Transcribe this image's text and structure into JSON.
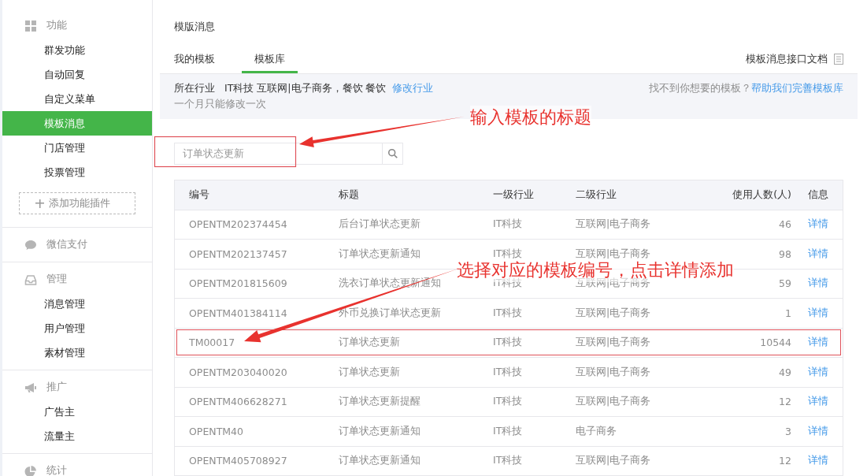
{
  "sidebar": {
    "sections": [
      {
        "label": "功能",
        "items": [
          {
            "label": "群发功能",
            "selected": false
          },
          {
            "label": "自动回复",
            "selected": false
          },
          {
            "label": "自定义菜单",
            "selected": false
          },
          {
            "label": "模板消息",
            "selected": true
          },
          {
            "label": "门店管理",
            "selected": false
          },
          {
            "label": "投票管理",
            "selected": false
          }
        ],
        "add_button": "添加功能插件"
      },
      {
        "label": "微信支付"
      },
      {
        "label": "管理",
        "items": [
          {
            "label": "消息管理",
            "selected": false
          },
          {
            "label": "用户管理",
            "selected": false
          },
          {
            "label": "素材管理",
            "selected": false
          }
        ]
      },
      {
        "label": "推广",
        "items": [
          {
            "label": "广告主",
            "selected": false
          },
          {
            "label": "流量主",
            "selected": false
          }
        ]
      },
      {
        "label": "统计"
      }
    ]
  },
  "page_title": "模版消息",
  "tabs": [
    {
      "label": "我的模板",
      "selected": false
    },
    {
      "label": "模板库",
      "selected": true
    }
  ],
  "doc_link": "模板消息接口文档",
  "industry": {
    "label": "所在行业",
    "value": "IT科技 互联网|电子商务，餐饮 餐饮",
    "edit_link": "修改行业",
    "note": "一个月只能修改一次",
    "help_text": "找不到你想要的模板？",
    "help_link": "帮助我们完善模板库"
  },
  "search": {
    "placeholder": "订单状态更新"
  },
  "table": {
    "columns": [
      "编号",
      "标题",
      "一级行业",
      "二级行业",
      "使用人数(人)",
      "信息"
    ],
    "rows": [
      {
        "id": "OPENTM202374454",
        "title": "后台订单状态更新",
        "industry_1": "IT科技",
        "industry_2": "互联网|电子商务",
        "users": "46",
        "action": "详情",
        "highlighted": false
      },
      {
        "id": "OPENTM202137457",
        "title": "订单状态更新通知",
        "industry_1": "IT科技",
        "industry_2": "互联网|电子商务",
        "users": "98",
        "action": "详情",
        "highlighted": false
      },
      {
        "id": "OPENTM201815609",
        "title": "洗衣订单状态更新通知",
        "industry_1": "IT科技",
        "industry_2": "互联网|电子商务",
        "users": "59",
        "action": "详情",
        "highlighted": false
      },
      {
        "id": "OPENTM401384114",
        "title": "外币兑换订单状态更新",
        "industry_1": "IT科技",
        "industry_2": "互联网|电子商务",
        "users": "1",
        "action": "详情",
        "highlighted": false
      },
      {
        "id": "TM00017",
        "title": "订单状态更新",
        "industry_1": "IT科技",
        "industry_2": "互联网|电子商务",
        "users": "10544",
        "action": "详情",
        "highlighted": true
      },
      {
        "id": "OPENTM203040020",
        "title": "订单状态更新",
        "industry_1": "IT科技",
        "industry_2": "互联网|电子商务",
        "users": "49",
        "action": "详情",
        "highlighted": false
      },
      {
        "id": "OPENTM406628271",
        "title": "订单状态更新提醒",
        "industry_1": "IT科技",
        "industry_2": "互联网|电子商务",
        "users": "12",
        "action": "详情",
        "highlighted": false
      },
      {
        "id": "OPENTM40",
        "title": "订单状态更新通知",
        "industry_1": "IT科技",
        "industry_2": "电子商务",
        "users": "3",
        "action": "详情",
        "highlighted": false
      },
      {
        "id": "OPENTM405708927",
        "title": "订单状态更新通知",
        "industry_1": "IT科技",
        "industry_2": "互联网|电子商务",
        "users": "12",
        "action": "详情",
        "highlighted": false
      }
    ]
  },
  "annotations": [
    {
      "text": "输入模板的标题"
    },
    {
      "text": "选择对应的模板编号，点击详情添加"
    }
  ]
}
